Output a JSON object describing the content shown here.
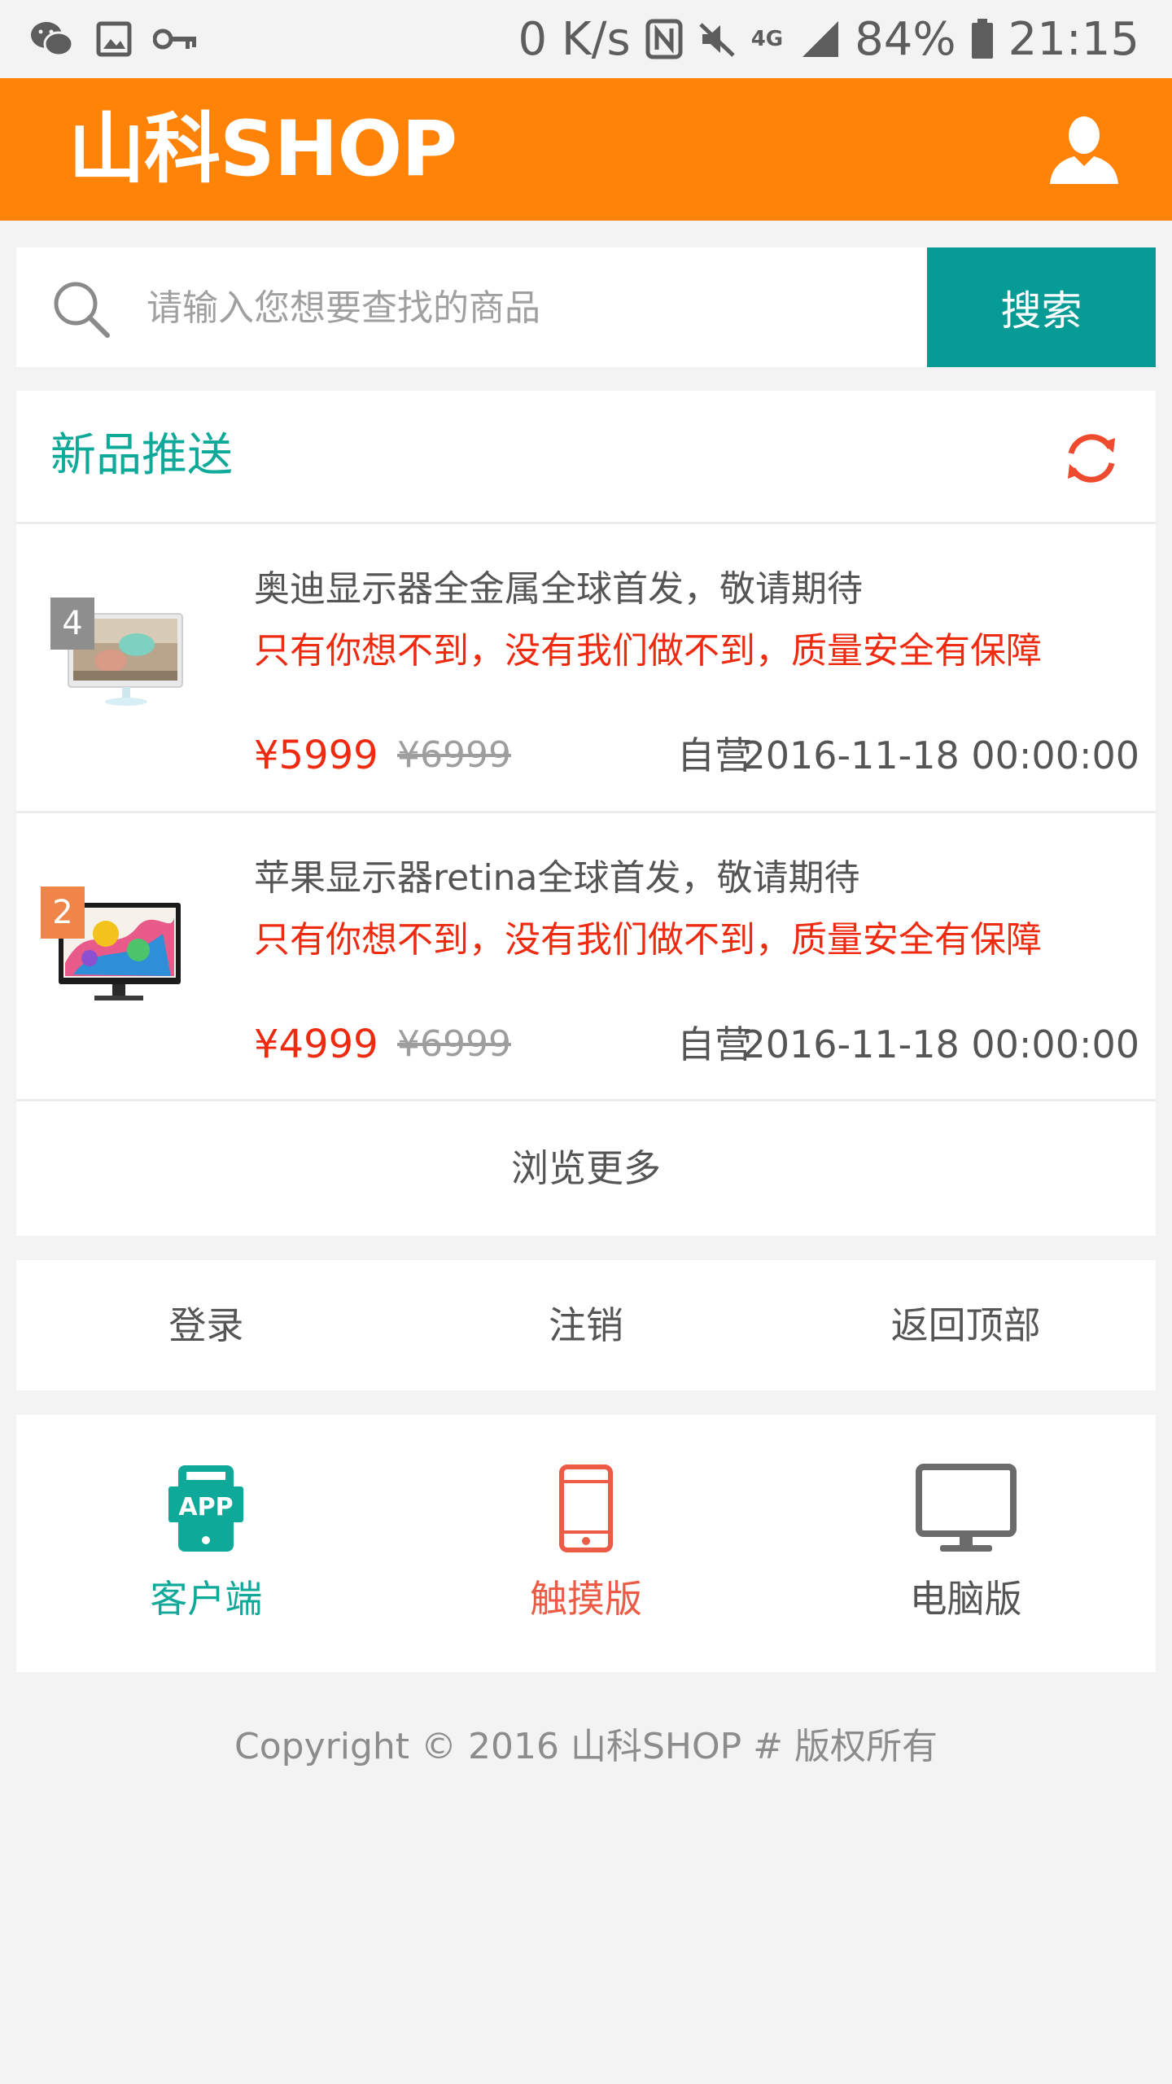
{
  "status_bar": {
    "speed": "0 K/s",
    "network": "4G",
    "battery": "84%",
    "time": "21:15",
    "icons": [
      "wechat-icon",
      "gallery-icon",
      "key-icon",
      "nfc-icon",
      "mute-icon",
      "signal-icon",
      "battery-icon"
    ]
  },
  "header": {
    "title": "山科SHOP",
    "user_icon": "user-icon"
  },
  "search": {
    "placeholder": "请输入您想要查找的商品",
    "value": "",
    "button": "搜索"
  },
  "new_products": {
    "title": "新品推送",
    "items": [
      {
        "rank": "4",
        "title": "奥迪显示器全金属全球首发，敬请期待",
        "slogan": "只有你想不到，没有我们做不到，质量安全有保障",
        "price": "¥5999",
        "old_price": "¥6999",
        "seller": "自营",
        "date": "2016-11-18 00:00:00"
      },
      {
        "rank": "2",
        "title": "苹果显示器retina全球首发，敬请期待",
        "slogan": "只有你想不到，没有我们做不到，质量安全有保障",
        "price": "¥4999",
        "old_price": "¥6999",
        "seller": "自营",
        "date": "2016-11-18 00:00:00"
      }
    ],
    "more": "浏览更多"
  },
  "links": {
    "login": "登录",
    "logout": "注销",
    "back_top": "返回顶部"
  },
  "versions": {
    "app": "客户端",
    "touch": "触摸版",
    "pc": "电脑版",
    "app_icon_text": "APP"
  },
  "copyright": "Copyright © 2016 山科SHOP # 版权所有",
  "colors": {
    "header": "#ff8307",
    "search_button": "#079b95",
    "accent_green": "#0fa99a",
    "price_red": "#ee2b10",
    "touch_red": "#ec5b45",
    "pc_gray": "#6b6b6b",
    "rank_gray": "#8e8e8e",
    "rank_orange": "#f0854a"
  }
}
